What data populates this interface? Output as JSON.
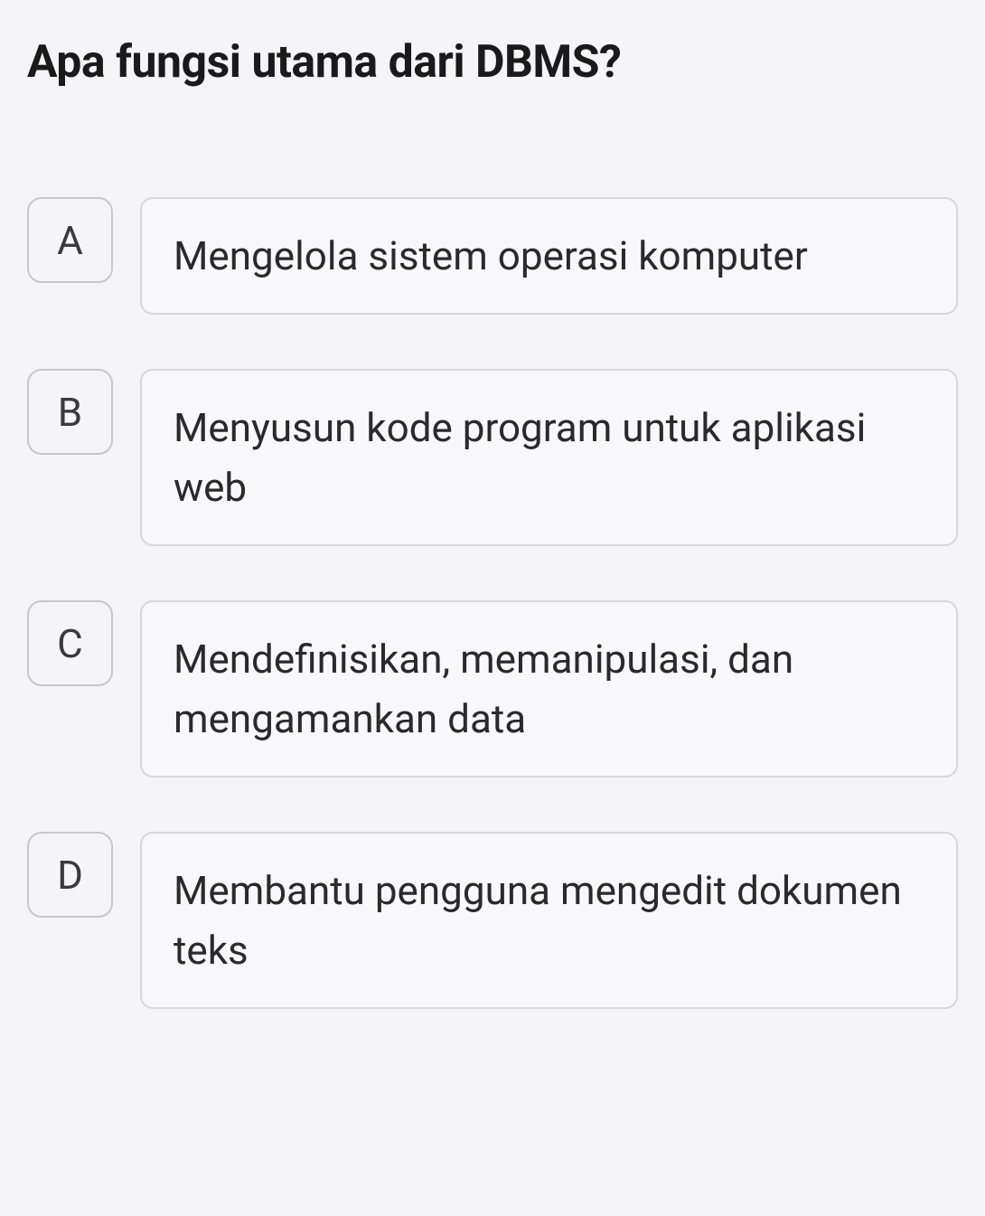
{
  "question": {
    "title": "Apa fungsi utama dari DBMS?"
  },
  "options": [
    {
      "letter": "A",
      "text": "Mengelola sistem operasi komputer"
    },
    {
      "letter": "B",
      "text": "Menyusun kode program untuk aplikasi web"
    },
    {
      "letter": "C",
      "text": "Mendefinisikan, memanipulasi, dan mengamankan data"
    },
    {
      "letter": "D",
      "text": "Membantu pengguna mengedit dokumen teks"
    }
  ]
}
